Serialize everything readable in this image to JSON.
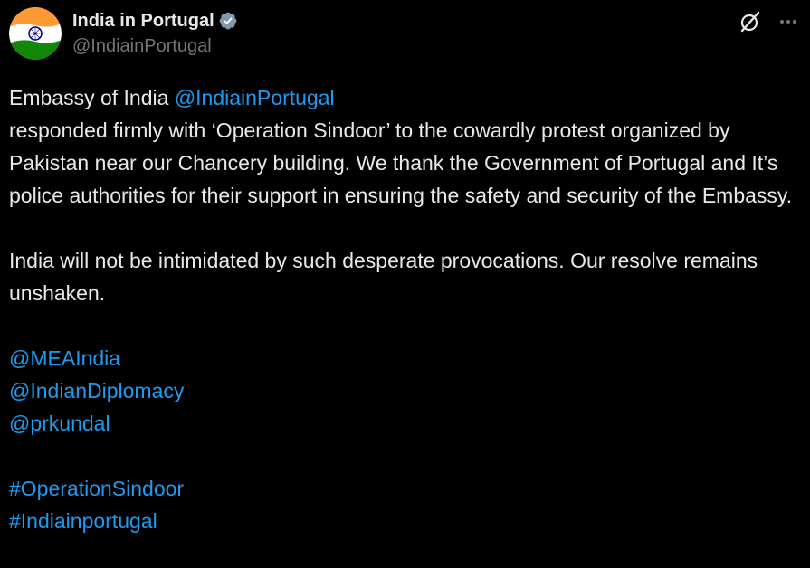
{
  "author": {
    "display_name": "India in Portugal",
    "handle": "@IndiainPortugal",
    "avatar_icon": "india-flag-avatar",
    "verified_icon": "verified-badge-icon",
    "verified_color": "#829aab"
  },
  "actions": {
    "grok_icon": "grok-icon",
    "more_icon": "more-icon"
  },
  "tweet": {
    "line1_text": "Embassy of India ",
    "line1_mention": "@IndiainPortugal",
    "paragraph1": "responded firmly with ‘Operation Sindoor’ to the cowardly protest organized by Pakistan near our Chancery building. We thank the Government of Portugal and It’s police authorities for their support in ensuring the safety and security of the Embassy.",
    "paragraph2": "India will not be intimidated by such desperate provocations. Our resolve remains unshaken.",
    "mentions": [
      "@MEAIndia",
      "@IndianDiplomacy",
      "@prkundal"
    ],
    "hashtags": [
      "#OperationSindoor",
      "#Indiainportugal"
    ]
  },
  "colors": {
    "background": "#000000",
    "text": "#e7e9ea",
    "secondary_text": "#71767b",
    "link": "#1d9bf0"
  }
}
